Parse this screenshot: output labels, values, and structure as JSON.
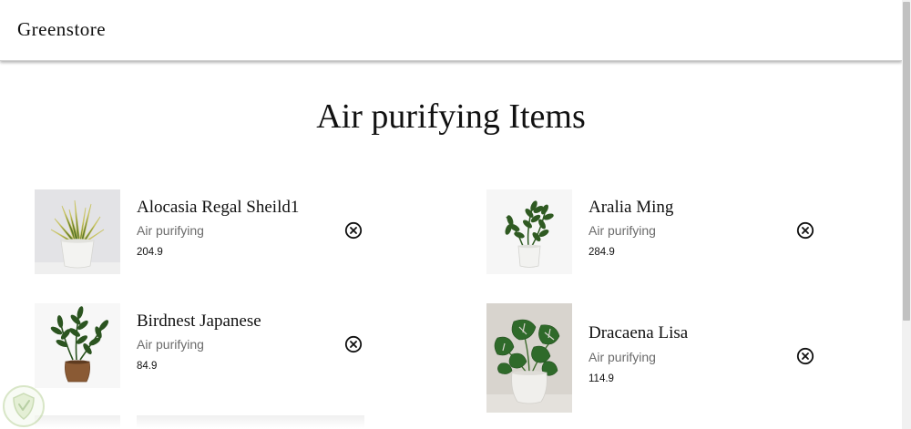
{
  "header": {
    "brand": "Greenstore"
  },
  "page": {
    "title": "Air purifying Items"
  },
  "products": [
    {
      "name": "Alocasia Regal Sheild1",
      "category": "Air purifying",
      "price": "204.9",
      "image_icon": "snake-plant-icon"
    },
    {
      "name": "Aralia Ming",
      "category": "Air purifying",
      "price": "284.9",
      "image_icon": "zz-plant-icon"
    },
    {
      "name": "Birdnest Japanese",
      "category": "Air purifying",
      "price": "84.9",
      "image_icon": "zz-plant-brown-pot-icon"
    },
    {
      "name": "Dracaena Lisa",
      "category": "Air purifying",
      "price": "114.9",
      "image_icon": "monstera-plant-icon"
    }
  ],
  "icons": {
    "remove": "close-circle-icon",
    "watermark": "shield-logo-icon"
  },
  "colors": {
    "leaf_green": "#3d6a2a",
    "pot_white": "#e9e9e6",
    "pot_brown": "#8a5a34",
    "muted_text": "#6b6b6b"
  }
}
